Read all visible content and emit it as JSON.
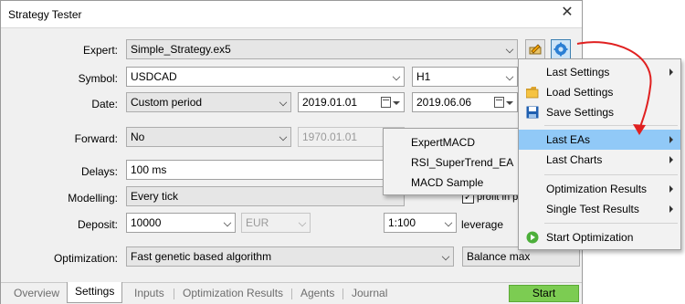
{
  "window": {
    "title": "Strategy Tester"
  },
  "form": {
    "expert": {
      "label": "Expert:",
      "value": "Simple_Strategy.ex5"
    },
    "symbol": {
      "label": "Symbol:",
      "value": "USDCAD",
      "timeframe": "H1"
    },
    "date": {
      "label": "Date:",
      "period": "Custom period",
      "from": "2019.01.01",
      "to": "2019.06.06"
    },
    "forward": {
      "label": "Forward:",
      "value": "No",
      "date": "1970.01.01"
    },
    "delays": {
      "label": "Delays:",
      "value": "100 ms"
    },
    "modelling": {
      "label": "Modelling:",
      "value": "Every tick",
      "profit_label": "profit in pips"
    },
    "deposit": {
      "label": "Deposit:",
      "value": "10000",
      "currency": "EUR",
      "leverage_value": "1:100",
      "leverage_label": "leverage"
    },
    "optimization": {
      "label": "Optimization:",
      "value": "Fast genetic based algorithm",
      "criterion": "Balance max"
    }
  },
  "tabs": [
    "Overview",
    "Settings",
    "Inputs",
    "Optimization Results",
    "Agents",
    "Journal"
  ],
  "active_tab": "Settings",
  "start_button": "Start",
  "context_menu": {
    "items": [
      {
        "label": "Last Settings",
        "submenu": true
      },
      {
        "label": "Load Settings",
        "icon": "folder-icon"
      },
      {
        "label": "Save Settings",
        "icon": "save-icon"
      },
      {
        "label": "Last EAs",
        "submenu": true,
        "highlighted": true
      },
      {
        "label": "Last Charts",
        "submenu": true
      },
      {
        "label": "Optimization Results",
        "submenu": true
      },
      {
        "label": "Single Test Results",
        "submenu": true
      },
      {
        "label": "Start Optimization",
        "icon": "play-icon"
      }
    ]
  },
  "submenu": {
    "items": [
      "ExpertMACD",
      "RSI_SuperTrend_EA",
      "MACD Sample"
    ]
  },
  "colors": {
    "menu_highlight": "#91c9f7",
    "start_button": "#7ccc52",
    "arrow": "#e02020",
    "gear_button": "#2b7fd4"
  }
}
